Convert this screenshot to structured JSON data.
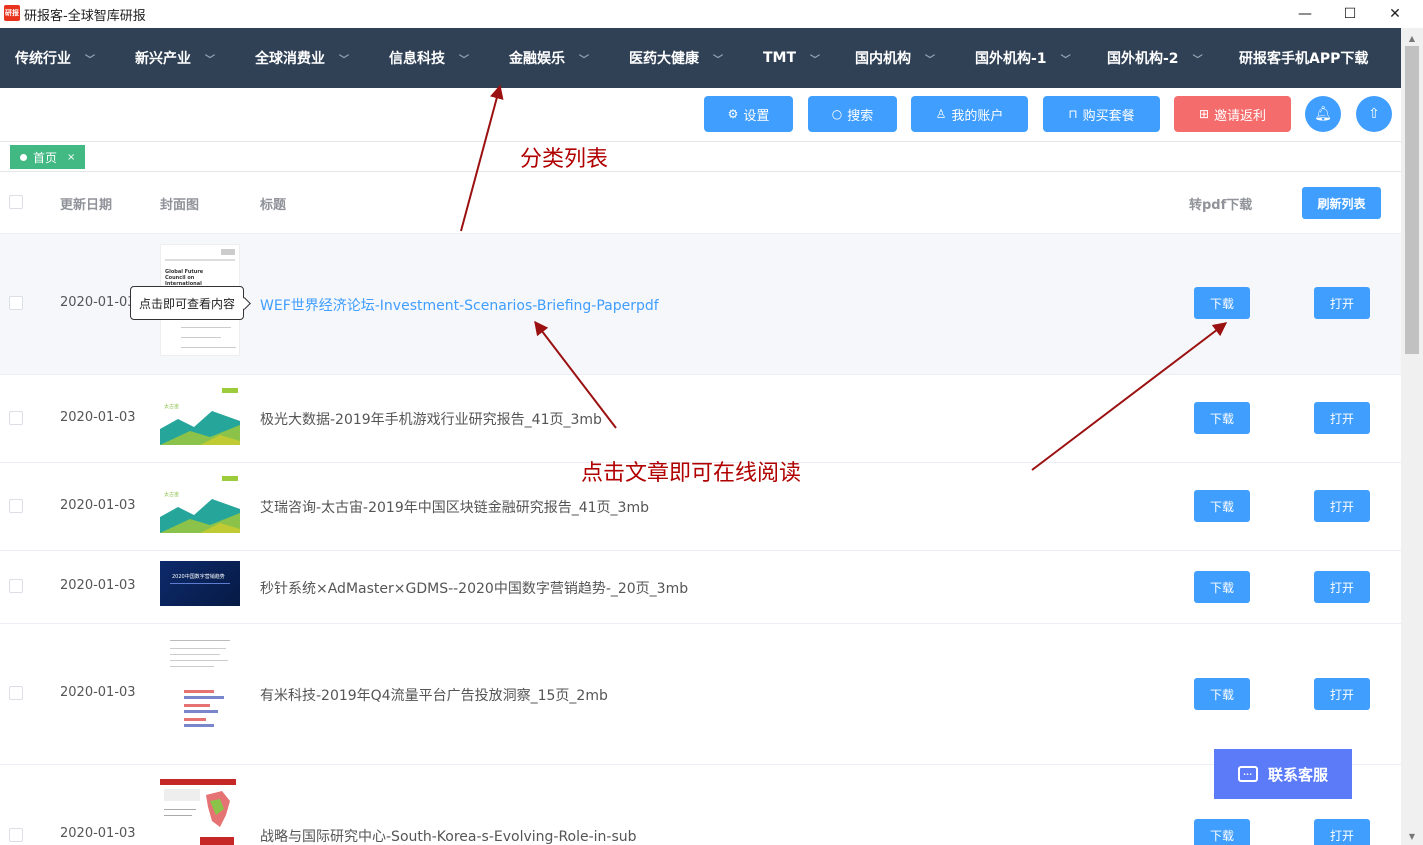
{
  "window": {
    "title": "研报客-全球智库研报",
    "icon_label": "研报",
    "controls": [
      "minimize-icon",
      "maximize-icon",
      "close-icon"
    ]
  },
  "nav": {
    "items": [
      {
        "label": "传统行业",
        "has_dropdown": true
      },
      {
        "label": "新兴产业",
        "has_dropdown": true
      },
      {
        "label": "全球消费业",
        "has_dropdown": true
      },
      {
        "label": "信息科技",
        "has_dropdown": true
      },
      {
        "label": "金融娱乐",
        "has_dropdown": true
      },
      {
        "label": "医药大健康",
        "has_dropdown": true
      },
      {
        "label": "TMT",
        "has_dropdown": true
      },
      {
        "label": "国内机构",
        "has_dropdown": true
      },
      {
        "label": "国外机构-1",
        "has_dropdown": true
      },
      {
        "label": "国外机构-2",
        "has_dropdown": true
      },
      {
        "label": "研报客手机APP下载",
        "has_dropdown": false
      }
    ]
  },
  "toolbar": {
    "settings": "设置",
    "search": "搜索",
    "account": "我的账户",
    "buy": "购买套餐",
    "invite": "邀请返利"
  },
  "tags": {
    "home": "首页"
  },
  "table": {
    "headers": {
      "date": "更新日期",
      "cover": "封面图",
      "title": "标题",
      "pdf": "转pdf下载"
    },
    "refresh": "刷新列表",
    "download": "下载",
    "open": "打开",
    "rows": [
      {
        "date": "2020-01-03",
        "title": "WEF世界经济论坛-Investment-Scenarios-Briefing-Paperpdf",
        "cover": "wef"
      },
      {
        "date": "2020-01-03",
        "title": "极光大数据-2019年手机游戏行业研究报告_41页_3mb",
        "cover": "mountain"
      },
      {
        "date": "2020-01-03",
        "title": "艾瑞咨询-太古宙-2019年中国区块链金融研究报告_41页_3mb",
        "cover": "mountain"
      },
      {
        "date": "2020-01-03",
        "title": "秒针系统×AdMaster×GDMS--2020中国数字营销趋势-_20页_3mb",
        "cover": "dark"
      },
      {
        "date": "2020-01-03",
        "title": "有米科技-2019年Q4流量平台广告投放洞察_15页_2mb",
        "cover": "doc"
      },
      {
        "date": "2020-01-03",
        "title": "战略与国际研究中心-South-Korea-s-Evolving-Role-in-sub",
        "cover": "map"
      }
    ]
  },
  "cover_text": {
    "wef": "Global Future Council on International Trade and Investment",
    "dark": "2020中国数字营销趋势",
    "mountain": "太古宙"
  },
  "tooltip": "点击即可查看内容",
  "annotations": {
    "category": "分类列表",
    "read": "点击文章即可在线阅读"
  },
  "contact": "联系客服",
  "colors": {
    "nav_bg": "#304156",
    "primary": "#409eff",
    "danger": "#f56c6c",
    "tag": "#42b983",
    "annotation": "#b00000",
    "contact": "#5b7bf9"
  }
}
